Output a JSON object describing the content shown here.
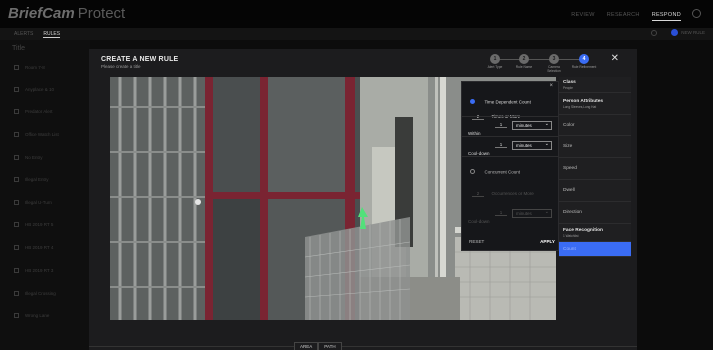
{
  "app": {
    "brand": "BriefCam",
    "product": "Protect"
  },
  "topnav": {
    "items": [
      "REVIEW",
      "RESEARCH",
      "RESPOND"
    ],
    "active": "RESPOND"
  },
  "subnav": {
    "tabs": [
      "ALERTS",
      "RULES"
    ],
    "active": "RULES",
    "new_rule": "NEW RULE"
  },
  "sidebar": {
    "title": "Title",
    "items": [
      "Room 7-8",
      "Anyplace & 10",
      "Predator Alert",
      "Office Watch List",
      "No Entry",
      "Illegal Entry",
      "Illegal U-Turn",
      "HB 2019 RT 5",
      "HB 2019 RT 4",
      "HB 2019 RT 3",
      "Illegal Crossing",
      "Wrong Lane"
    ]
  },
  "modal": {
    "title": "CREATE A NEW RULE",
    "subtitle": "Please create a title",
    "steps": [
      {
        "num": "1",
        "label": "Alert Type"
      },
      {
        "num": "2",
        "label": "Rule Name"
      },
      {
        "num": "3",
        "label": "Camera Selection"
      },
      {
        "num": "4",
        "label": "Rule Refinement"
      }
    ],
    "active_step": 4
  },
  "properties": [
    {
      "name": "Class",
      "sub": "People",
      "bold": true
    },
    {
      "name": "Person Attributes",
      "sub": "Long Sleeves,Long Hat",
      "bold": true
    },
    {
      "name": "Color"
    },
    {
      "name": "Size"
    },
    {
      "name": "Speed"
    },
    {
      "name": "Dwell"
    },
    {
      "name": "Direction"
    },
    {
      "name": "Face Recognition",
      "sub": "1 Watchlist",
      "bold": true
    },
    {
      "name": "Count",
      "active": true
    }
  ],
  "count_popover": {
    "option1_label": "Time Dependent Count",
    "times_value": "2",
    "times_label": "Times or More",
    "within_label": "Within",
    "within_value": "1",
    "within_unit": "minutes",
    "cooldown_label": "Cool-down",
    "cooldown_value": "1",
    "cooldown_unit": "minutes",
    "option2_label": "Concurrent Count",
    "occurrences_value": "2",
    "occurrences_label": "Occurrences or More",
    "cooldown2_label": "Cool-down",
    "cooldown2_value": "1",
    "cooldown2_unit": "minutes",
    "reset": "RESET",
    "apply": "APPLY"
  },
  "bottom_tabs": [
    "AREA",
    "PATH"
  ],
  "colors": {
    "accent": "#3a6cf4",
    "modal_bg": "#1c1c1e",
    "page_bg": "#0c0c0c"
  }
}
